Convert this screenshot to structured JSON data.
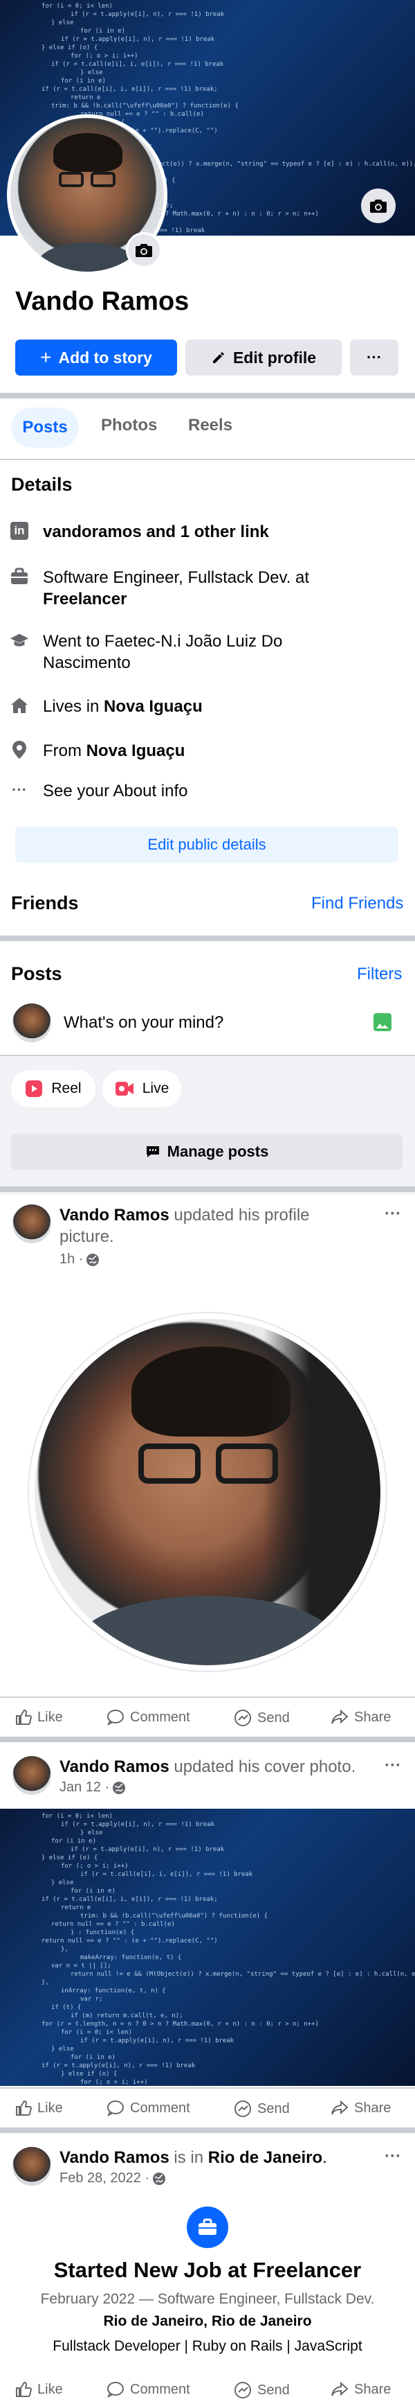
{
  "profile": {
    "name": "Vando Ramos",
    "add_story_label": "Add to story",
    "edit_profile_label": "Edit profile",
    "more_label": "···"
  },
  "tabs": [
    {
      "label": "Posts",
      "active": true
    },
    {
      "label": "Photos",
      "active": false
    },
    {
      "label": "Reels",
      "active": false
    }
  ],
  "details": {
    "heading": "Details",
    "link": "vandoramos and 1 other link",
    "work_pre": "Software Engineer, Fullstack Dev. at",
    "work_company": "Freelancer",
    "education_line1": "Went to Faetec-N.i João Luiz Do",
    "education_line2": "Nascimento",
    "lives_pre": "Lives in",
    "lives_city": "Nova Iguaçu",
    "from_pre": "From",
    "from_city": "Nova Iguaçu",
    "about": "See your About info",
    "edit_public": "Edit public details"
  },
  "friends": {
    "heading": "Friends",
    "find_label": "Find Friends"
  },
  "posts_section": {
    "heading": "Posts",
    "filters_label": "Filters",
    "composer_placeholder": "What's on your mind?",
    "reel_label": "Reel",
    "live_label": "Live",
    "manage_label": "Manage posts"
  },
  "posts": [
    {
      "author": "Vando Ramos",
      "action_line1": "updated his profile",
      "action_line2": "picture.",
      "time": "1h ·"
    },
    {
      "author": "Vando Ramos",
      "action": "updated his cover photo.",
      "time": "Jan 12 ·"
    },
    {
      "author": "Vando Ramos",
      "action_pre": "is in",
      "place": "Rio de Janeiro",
      "action_post": ".",
      "time": "Feb 28, 2022 ·",
      "event_title": "Started New Job at Freelancer",
      "event_sub": "February 2022 — Software Engineer, Fullstack Dev.",
      "event_place": "Rio de Janeiro, Rio de Janeiro",
      "event_desc": "Fullstack Developer | Ruby on Rails | JavaScript"
    }
  ],
  "post_actions": {
    "like": "Like",
    "comment": "Comment",
    "send": "Send",
    "share": "Share"
  },
  "colors": {
    "accent": "#0866ff",
    "light_blue_bg": "#ebf5ff",
    "button_gray": "#e4e6eb",
    "divider": "#c9ccd1",
    "reel_red": "#f3425f",
    "photo_green": "#45bd62"
  },
  "code_snippets": [
    "for (i = 0; i< len)",
    "if (r = t.apply(e[i], n), r === !1) break",
    "} else",
    "for (i in e)",
    "if (r = t.apply(e[i], n), r === !1) break",
    "} else if (o) {",
    "for (; o > i; i++)",
    "if (r = t.call(e[i], i, e[i]), r === !1) break",
    "} else",
    "for (i in e)",
    "if (r = t.call(e[i], i, e[i]), r === !1) break;",
    "return e",
    "trim: b && !b.call(\"\\ufeff\\u00a0\") ? function(e) {",
    "return null == e ? \"\" : b.call(e)",
    "} : function(e) {",
    "return null == e ? \"\" : (e + \"\").replace(C, \"\")",
    "},",
    "makeArray: function(e, t) {",
    "var n = t || [];",
    "return null != e && (M(Object(e)) ? x.merge(n, \"string\" == typeof e ? [e] : e) : h.call(n, e)), n",
    "},",
    "inArray: function(e, t, n) {",
    "var r;",
    "if (t) {",
    "if (m) return m.call(t, e, n);",
    "for (r = t.length, n = n ? 0 > n ? Math.max(0, r + n) : n : 0; r > n; n++)"
  ]
}
